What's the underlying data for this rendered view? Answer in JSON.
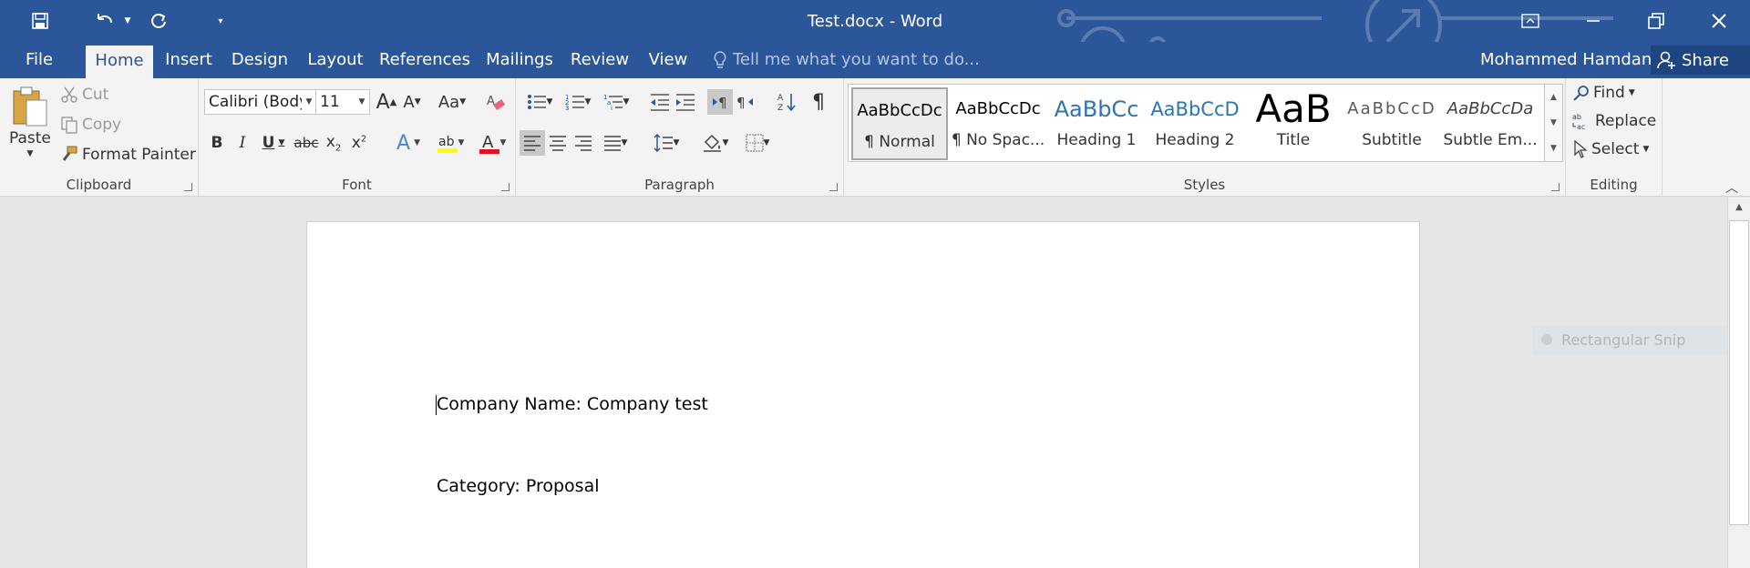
{
  "window": {
    "title": "Test.docx - Word",
    "user": "Mohammed Hamdan",
    "share_label": "Share"
  },
  "tabs": [
    {
      "label": "File"
    },
    {
      "label": "Home"
    },
    {
      "label": "Insert"
    },
    {
      "label": "Design"
    },
    {
      "label": "Layout"
    },
    {
      "label": "References"
    },
    {
      "label": "Mailings"
    },
    {
      "label": "Review"
    },
    {
      "label": "View"
    }
  ],
  "active_tab": "Home",
  "tell_me": {
    "placeholder": "Tell me what you want to do..."
  },
  "clipboard": {
    "group_label": "Clipboard",
    "paste": "Paste",
    "cut": "Cut",
    "copy": "Copy",
    "format_painter": "Format Painter"
  },
  "font": {
    "group_label": "Font",
    "name": "Calibri (Body)",
    "size": "11",
    "change_case": "Aa",
    "bold": "B",
    "italic": "I",
    "underline": "U",
    "strike": "abc",
    "grow": "A",
    "shrink": "A",
    "highlight_color": "#ffff00",
    "font_color": "#e81123"
  },
  "paragraph": {
    "group_label": "Paragraph"
  },
  "styles": {
    "group_label": "Styles",
    "items": [
      {
        "sample": "AaBbCcDc",
        "name": "¶ Normal"
      },
      {
        "sample": "AaBbCcDc",
        "name": "¶ No Spac..."
      },
      {
        "sample": "AaBbCc",
        "name": "Heading 1"
      },
      {
        "sample": "AaBbCcD",
        "name": "Heading 2"
      },
      {
        "sample": "AaB",
        "name": "Title"
      },
      {
        "sample": "AaBbCcD",
        "name": "Subtitle"
      },
      {
        "sample": "AaBbCcDa",
        "name": "Subtle Em..."
      }
    ]
  },
  "editing": {
    "group_label": "Editing",
    "find": "Find",
    "replace": "Replace",
    "select": "Select"
  },
  "document": {
    "paragraphs": [
      "Company Name: Company test",
      "Category: Proposal"
    ]
  },
  "overlay": {
    "snip_label": "Rectangular Snip"
  },
  "colors": {
    "brand": "#2b579a",
    "heading": "#2e74b5"
  }
}
